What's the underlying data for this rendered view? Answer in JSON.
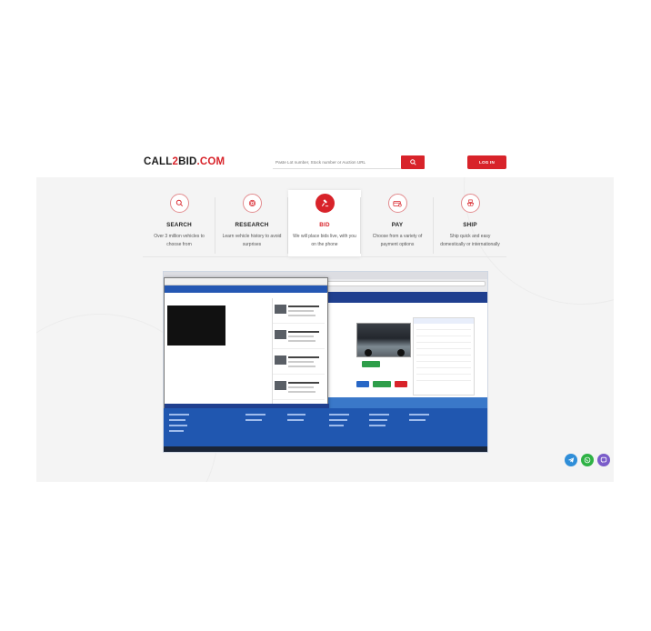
{
  "brand": {
    "prefix": "CALL",
    "two": "2",
    "mid": "BID",
    "suffix": ".COM"
  },
  "search": {
    "placeholder": "Paste Lot number, Stock number or Auction URL"
  },
  "login": {
    "label": "LOG IN"
  },
  "steps": [
    {
      "title": "SEARCH",
      "desc": "Over 3 million vehicles to choose from",
      "icon": "magnifier-icon"
    },
    {
      "title": "RESEARCH",
      "desc": "Learn vehicle history to avoid surprises",
      "icon": "fingerprint-icon"
    },
    {
      "title": "BID",
      "desc": "We will place bids live, with you on the phone",
      "icon": "gavel-icon"
    },
    {
      "title": "PAY",
      "desc": "Choose from a variety of payment options",
      "icon": "payment-card-icon"
    },
    {
      "title": "SHIP",
      "desc": "Ship quick and easy domestically or internationally",
      "icon": "cargo-ship-icon"
    }
  ],
  "social": [
    {
      "name": "telegram-icon",
      "color": "#2f8ed8"
    },
    {
      "name": "whatsapp-icon",
      "color": "#2eb245"
    },
    {
      "name": "viber-icon",
      "color": "#7a5cc9"
    }
  ],
  "colors": {
    "accent": "#d8232a",
    "band": "#f4f4f4"
  }
}
